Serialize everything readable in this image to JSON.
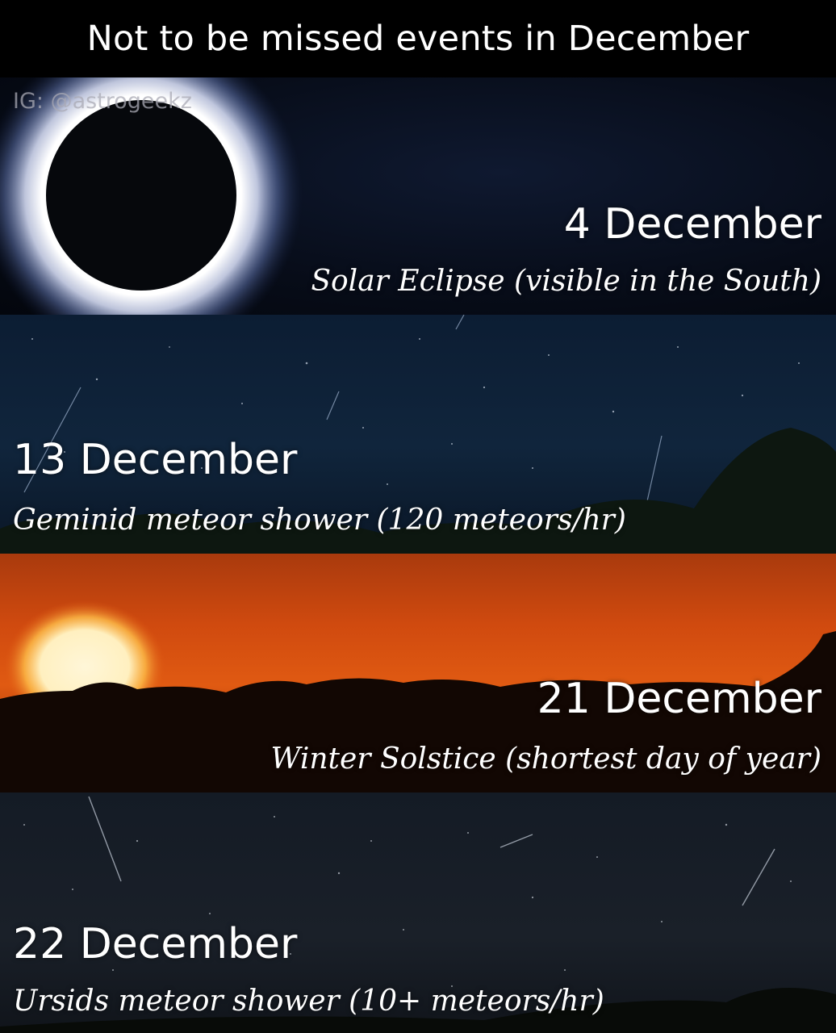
{
  "header": {
    "title": "Not to be missed events in December"
  },
  "watermark": "IG: @astrogeekz",
  "events": [
    {
      "date": "4 December",
      "description": "Solar Eclipse (visible in the South)"
    },
    {
      "date": "13 December",
      "description": "Geminid meteor shower (120 meteors/hr)"
    },
    {
      "date": "21 December",
      "description": "Winter Solstice (shortest day of year)"
    },
    {
      "date": "22 December",
      "description": "Ursids meteor shower (10+ meteors/hr)"
    }
  ],
  "colors": {
    "header_bg": "#000000",
    "text": "#ffffff",
    "sunset": "#e05a12"
  }
}
